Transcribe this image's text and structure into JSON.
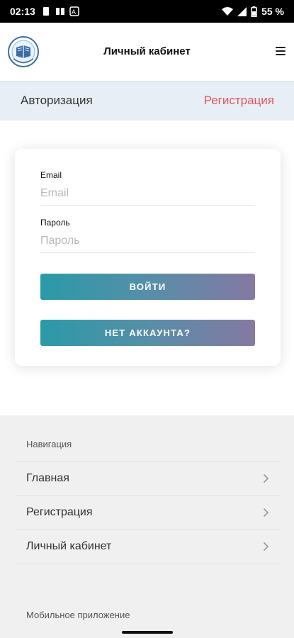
{
  "status_bar": {
    "time": "02:13",
    "battery": "55 %",
    "icons": [
      "notification-icon",
      "book-icon",
      "translate-icon",
      "wifi-icon",
      "signal-icon",
      "battery-icon"
    ]
  },
  "header": {
    "title": "Личный кабинет",
    "logo_icon": "university-logo-icon",
    "menu_icon": "hamburger-menu-icon"
  },
  "tabs": {
    "auth_label": "Авторизация",
    "register_label": "Регистрация",
    "register_color": "#e0575f"
  },
  "form": {
    "email_label": "Email",
    "email_placeholder": "Email",
    "password_label": "Пароль",
    "password_placeholder": "Пароль",
    "login_button": "ВОЙТИ",
    "no_account_button": "НЕТ АККАУНТА?",
    "button_gradient": [
      "#2a9aa8",
      "#8579a2"
    ]
  },
  "footer": {
    "nav_title": "Навигация",
    "nav_items": [
      {
        "label": "Главная"
      },
      {
        "label": "Регистрация"
      },
      {
        "label": "Личный кабинет"
      }
    ],
    "mobile_title": "Мобильное приложение"
  }
}
